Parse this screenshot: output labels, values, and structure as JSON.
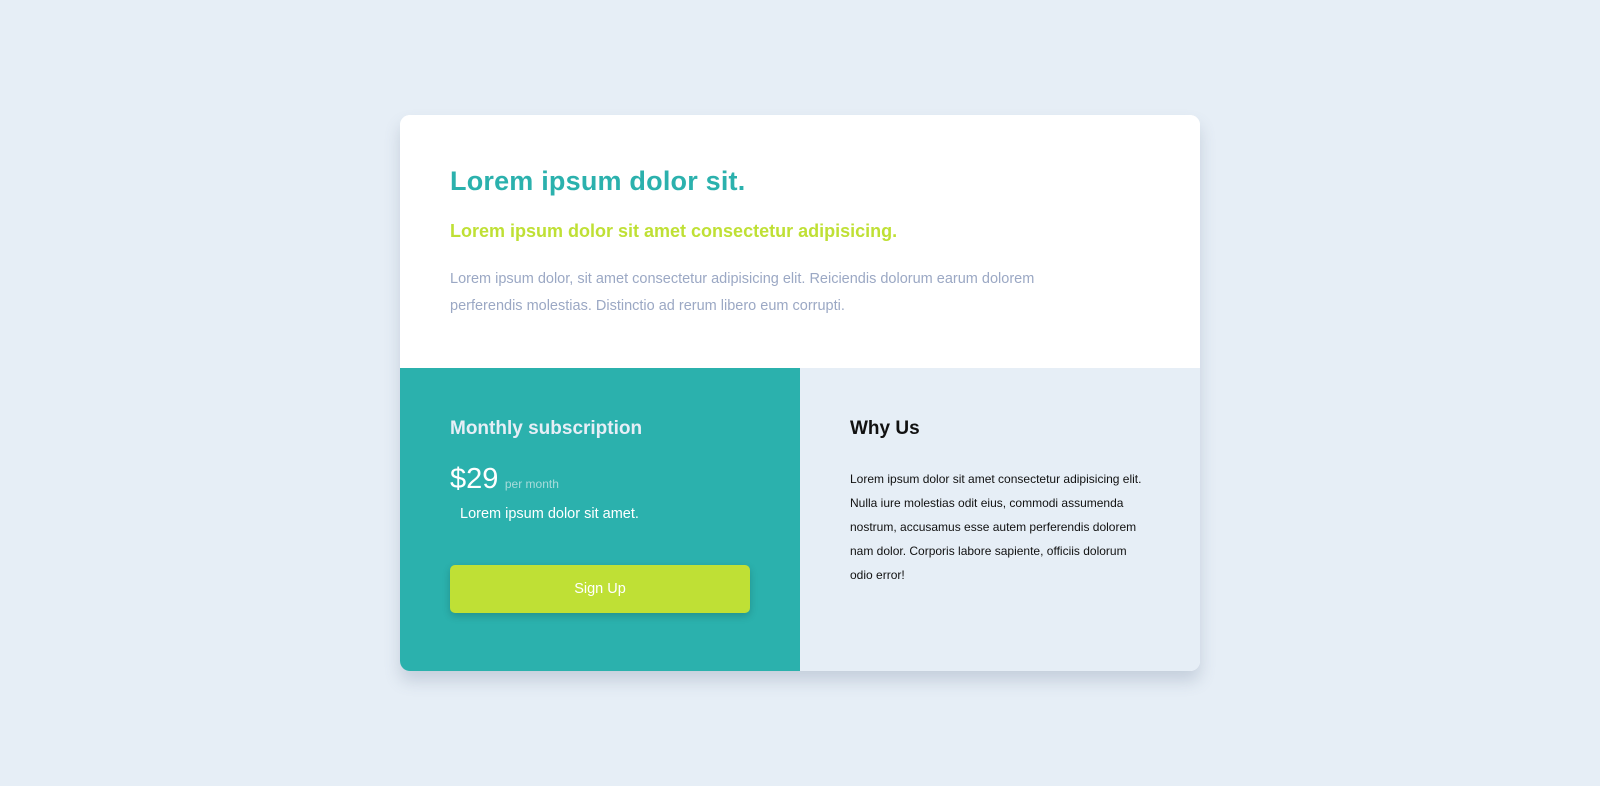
{
  "header": {
    "title": "Lorem ipsum dolor sit.",
    "subtitle": "Lorem ipsum dolor sit amet consectetur adipisicing.",
    "description": "Lorem ipsum dolor, sit amet consectetur adipisicing elit. Reiciendis dolorum earum dolorem perferendis molestias. Distinctio ad rerum libero eum corrupti."
  },
  "subscription": {
    "title": "Monthly subscription",
    "price": "$29",
    "period": "per month",
    "description": "Lorem ipsum dolor sit amet.",
    "button_label": "Sign Up"
  },
  "why_us": {
    "title": "Why Us",
    "text": "Lorem ipsum dolor sit amet consectetur adipisicing elit. Nulla iure molestias odit eius, commodi assumenda nostrum, accusamus esse autem perferendis dolorem nam dolor. Corporis labore sapiente, officiis dolorum odio error!"
  },
  "colors": {
    "background": "#e6eef6",
    "primary_teal": "#2bb1ad",
    "accent_lime": "#bfe035",
    "muted_text": "#9ba8c4"
  }
}
